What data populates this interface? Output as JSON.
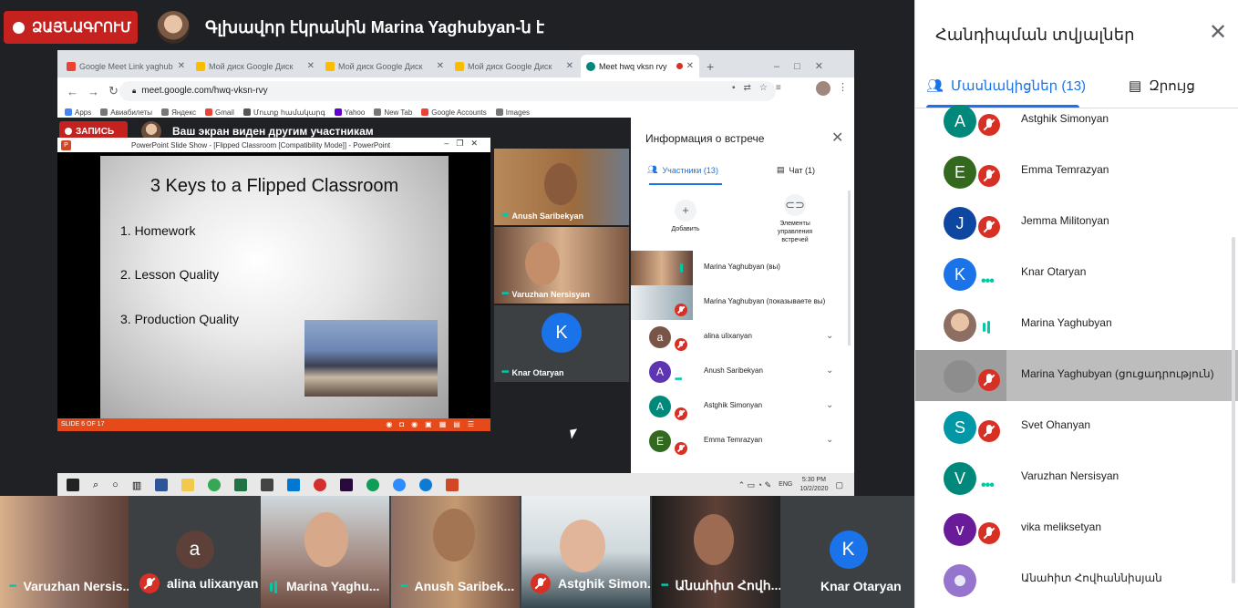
{
  "top": {
    "record_label": "ՁԱՅՆԱԳՐՈՒՄ",
    "presenting_text": "Գլխավոր էկրանին Marina Yaghubyan-ն է"
  },
  "browser": {
    "tabs": [
      {
        "label": "Google Meet Link  yaghub",
        "color": "#ea4335"
      },
      {
        "label": "Мой диск  Google Диск",
        "color": "#fbbc04"
      },
      {
        "label": "Мой диск  Google Диск",
        "color": "#fbbc04"
      },
      {
        "label": "Мой диск  Google Диск",
        "color": "#fbbc04"
      },
      {
        "label": "Meet  hwq vksn rvy",
        "color": "#00897b"
      }
    ],
    "url": "meet.google.com/hwq-vksn-rvy",
    "bookmarks": [
      "Apps",
      "Авиабилеты",
      "Яндекс",
      "Gmail",
      "Մուտք համակարգ",
      "Yahoo",
      "New Tab",
      "Google Accounts",
      "Images"
    ]
  },
  "meet": {
    "record_label": "ЗАПИСЬ",
    "presenting_text": "Ваш экран виден другим участникам",
    "ppt_title": "PowerPoint Slide Show - [Flipped Classroom [Compatibility Mode]] - PowerPoint",
    "slide": {
      "title": "3 Keys to a Flipped Classroom",
      "items": [
        "1.  Homework",
        "2.  Lesson Quality",
        "3.  Production Quality"
      ]
    },
    "slide_status": "SLIDE 6 OF 17",
    "tiles": [
      {
        "name": "Anush Saribekyan"
      },
      {
        "name": "Varuzhan Nersisyan"
      },
      {
        "name": "Knar Otaryan",
        "initial": "K",
        "color": "#1a73e8"
      }
    ],
    "info": {
      "title": "Информация о встрече",
      "tab_people": "Участники (13)",
      "tab_chat": "Чат (1)",
      "add_label": "Добавить",
      "controls_label": "Элементы управления встречей",
      "rows": [
        {
          "name": "Marina Yaghubyan (вы)"
        },
        {
          "name": "Marina Yaghubyan (показываете вы)"
        },
        {
          "name": "alina ulixanyan",
          "initial": "a",
          "color": "#795548"
        },
        {
          "name": "Anush Saribekyan",
          "initial": "A",
          "color": "#5e35b1"
        },
        {
          "name": "Astghik Simonyan",
          "initial": "A",
          "color": "#00897b"
        },
        {
          "name": "Emma Temrazyan",
          "initial": "E",
          "color": "#33691e"
        }
      ]
    },
    "taskbar": {
      "lang": "ENG",
      "time": "5:30 PM",
      "date": "10/2/2020"
    }
  },
  "strip": [
    {
      "name": "Varuzhan Nersis...",
      "status": "dots"
    },
    {
      "name": "alina ulixanyan",
      "status": "muted",
      "initial": "a",
      "color": "#5d4037"
    },
    {
      "name": "Marina Yaghu...",
      "status": "speaking"
    },
    {
      "name": "Anush Saribek...",
      "status": "dots"
    },
    {
      "name": "Astghik Simon...",
      "status": "muted"
    },
    {
      "name": "Անահիտ Հովհ...",
      "status": "dots"
    },
    {
      "name": "Knar Otaryan",
      "status": "none",
      "initial": "K",
      "color": "#1a73e8"
    }
  ],
  "panel": {
    "title": "Հանդիպման տվյալներ",
    "tab_people": "Մասնակիցներ (13)",
    "tab_chat": "Զրույց",
    "participants": [
      {
        "name": "Astghik Simonyan",
        "initial": "A",
        "color": "#00897b",
        "status": "muted"
      },
      {
        "name": "Emma Temrazyan",
        "initial": "E",
        "color": "#33691e",
        "status": "muted"
      },
      {
        "name": "Jemma Militonyan",
        "initial": "J",
        "color": "#0d47a1",
        "status": "muted"
      },
      {
        "name": "Knar Otaryan",
        "initial": "K",
        "color": "#1a73e8",
        "status": "dots"
      },
      {
        "name": "Marina Yaghubyan",
        "initial": "",
        "color": "#8d6e63",
        "status": "speaking"
      },
      {
        "name": "Marina Yaghubyan (ցուցադրություն)",
        "initial": "",
        "color": "#9e9e9e",
        "status": "muted"
      },
      {
        "name": "Svet Ohanyan",
        "initial": "S",
        "color": "#0097a7",
        "status": "muted"
      },
      {
        "name": "Varuzhan Nersisyan",
        "initial": "V",
        "color": "#00897b",
        "status": "dots"
      },
      {
        "name": "vika meliksetyan",
        "initial": "v",
        "color": "#6a1b9a",
        "status": "muted"
      },
      {
        "name": "Անահիտ Հովհաննիսյան",
        "initial": "",
        "color": "#9575cd",
        "status": "none"
      }
    ]
  }
}
